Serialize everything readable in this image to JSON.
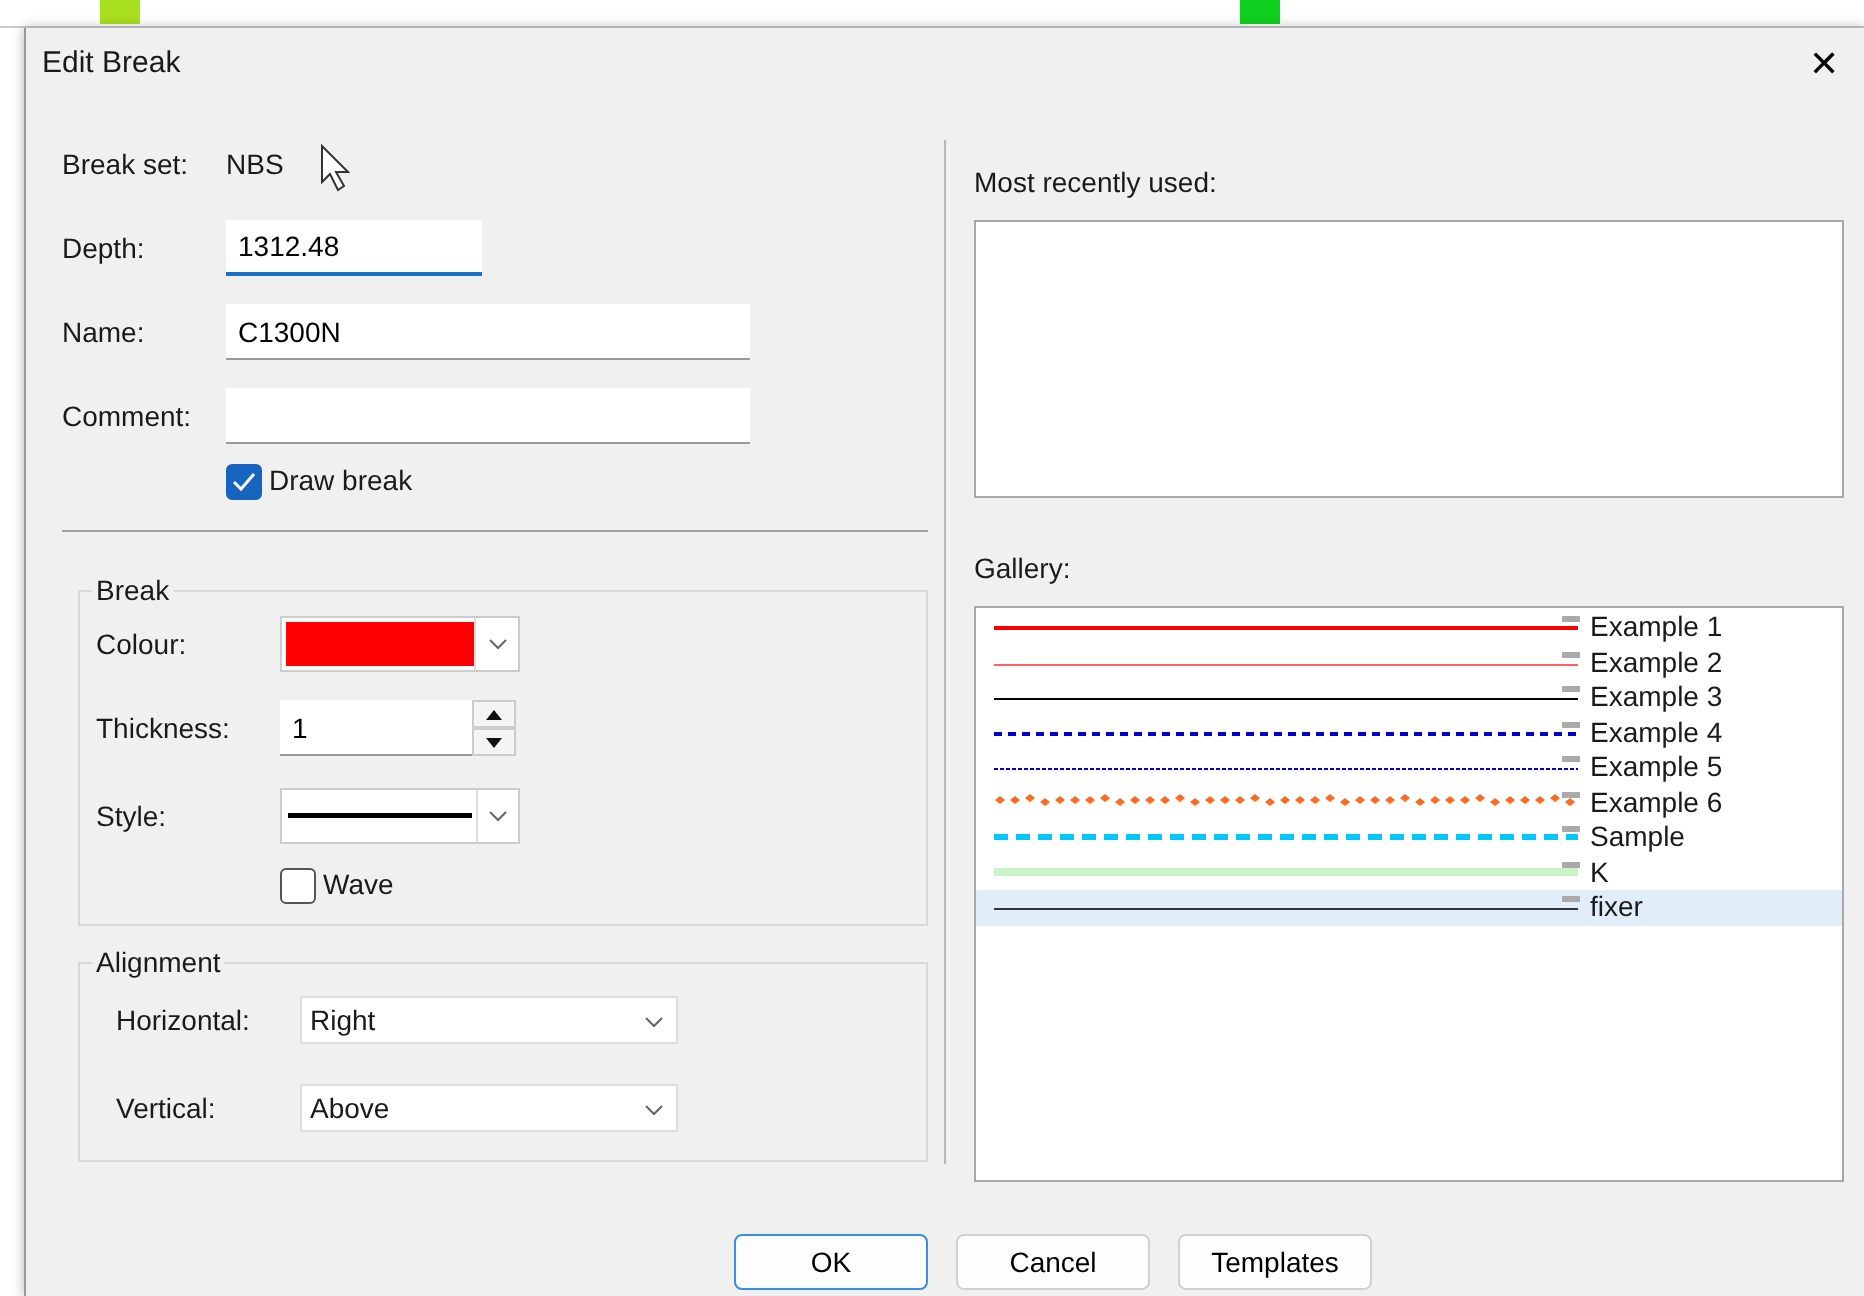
{
  "window": {
    "title": "Edit Break",
    "close": "✕"
  },
  "form": {
    "break_set_label": "Break set:",
    "break_set": "NBS",
    "fields": [
      {
        "label": "Depth:",
        "value": "1312.48",
        "focused": true
      },
      {
        "label": "Name:",
        "value": "C1300N",
        "focused": false
      },
      {
        "label": "Comment:",
        "focused": false
      }
    ],
    "draw_break": {
      "label": "Draw break",
      "checked": true
    }
  },
  "break_group": {
    "title": "Break",
    "colour_label": "Colour:",
    "colour_swatch": {
      "color": "#ff0000"
    },
    "thickness_label": "Thickness:",
    "thickness": "1",
    "style_label": "Style:",
    "wave": {
      "label": "Wave",
      "checked": false
    }
  },
  "alignment_group": {
    "title": "Alignment",
    "rows": [
      {
        "label": "Horizontal:",
        "value": "Right"
      },
      {
        "label": "Vertical:",
        "value": "Above"
      }
    ]
  },
  "recent": {
    "label": "Most recently used:"
  },
  "gallery": {
    "label": "Gallery:",
    "items": [
      {
        "name": "Example 1",
        "kind": "heavy",
        "color": "#ff0000",
        "selected": false
      },
      {
        "name": "Example 2",
        "kind": "solid",
        "color": "#ff6060",
        "selected": false
      },
      {
        "name": "Example 3",
        "kind": "solid",
        "color": "#000000",
        "selected": false
      },
      {
        "name": "Example 4",
        "kind": "dashed",
        "color": "#0000cc",
        "selected": false
      },
      {
        "name": "Example 5",
        "kind": "dotted",
        "color": "#0000cc",
        "selected": false
      },
      {
        "name": "Example 6",
        "kind": "diamonds",
        "color": "#ff6a20",
        "selected": false
      },
      {
        "name": "Sample",
        "kind": "stripe",
        "color": "#00c8ff",
        "selected": false
      },
      {
        "name": "K",
        "kind": "band",
        "color": "#c8f5c8",
        "selected": false
      },
      {
        "name": "fixer",
        "kind": "solid",
        "color": "#333333",
        "selected": true
      }
    ]
  },
  "buttons": [
    {
      "label": "OK",
      "default": true
    },
    {
      "label": "Cancel",
      "default": false
    },
    {
      "label": "Templates",
      "default": false
    }
  ]
}
